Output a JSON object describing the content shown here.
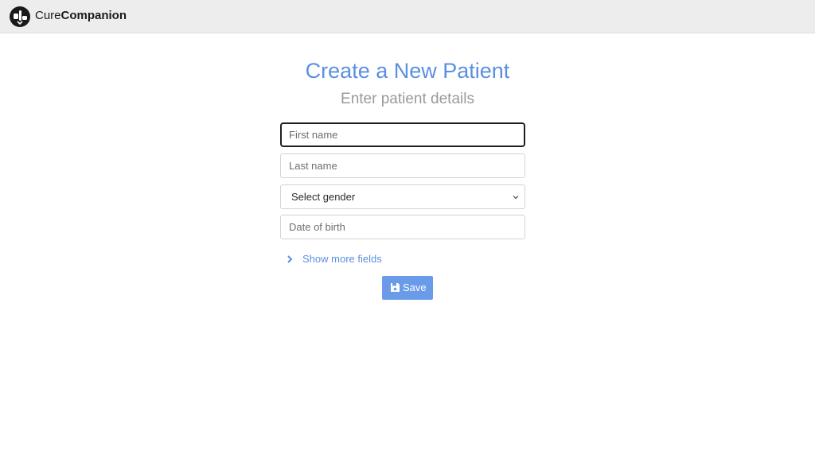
{
  "header": {
    "brand_light": "Cure",
    "brand_bold": "Companion",
    "logo_icon": "pill-heart-logo-icon"
  },
  "form": {
    "title": "Create a New Patient",
    "subtitle": "Enter patient details",
    "first_name": {
      "value": "",
      "placeholder": "First name"
    },
    "last_name": {
      "value": "",
      "placeholder": "Last name"
    },
    "gender": {
      "selected": "Select gender",
      "icon": "chevron-down-icon"
    },
    "date_of_birth": {
      "value": "",
      "placeholder": "Date of birth"
    },
    "show_more": {
      "label": "Show more fields",
      "icon": "chevron-right-icon"
    },
    "save": {
      "label": "Save",
      "icon": "save-icon"
    }
  },
  "colors": {
    "accent": "#5b8fe0",
    "button": "#6a9be8",
    "header_bg": "#ededed",
    "subtitle": "#9a9a9a"
  }
}
